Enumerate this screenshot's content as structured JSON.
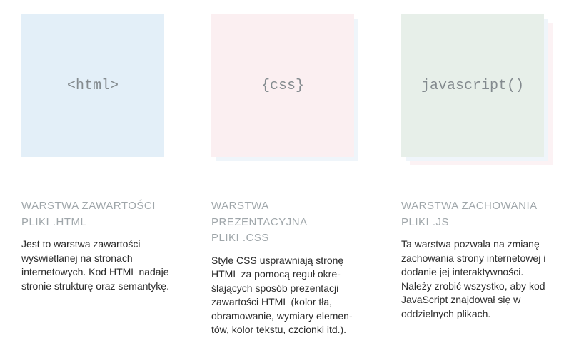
{
  "columns": [
    {
      "tile_label": "<html>",
      "title_line1": "WARSTWA ZAWARTOŚCI",
      "title_line2": "PLIKI .HTML",
      "description": "Jest to warstwa zawartości wyświetlanej na stronach internetowych. Kod HTML nadaje stronie strukturę oraz semantykę."
    },
    {
      "tile_label": "{css}",
      "title_line1": "WARSTWA PREZENTACYJNA",
      "title_line2": "PLIKI .CSS",
      "description": "Style CSS usprawniają stronę HTML za pomocą reguł okre­ślających sposób prezentacji zawartości HTML (kolor tła, obramowanie, wymiary elemen­tów, kolor tekstu, czcionki itd.)."
    },
    {
      "tile_label": "javascript()",
      "title_line1": "WARSTWA ZACHOWANIA",
      "title_line2": "PLIKI .JS",
      "description": "Ta warstwa pozwala na zmianę zachowania strony internetowej i dodanie jej interaktywności. Należy zrobić wszystko, aby kod JavaScript znajdował się w oddzielnych plikach."
    }
  ]
}
